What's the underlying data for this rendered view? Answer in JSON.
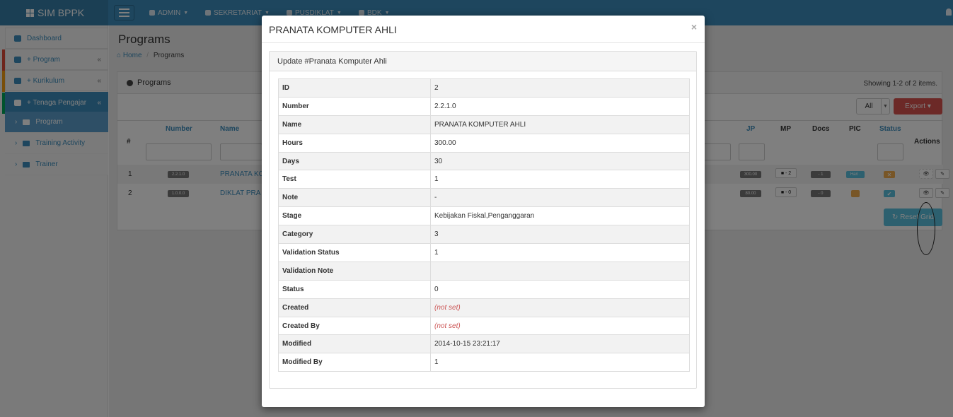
{
  "app": {
    "brand": "SIM BPPK"
  },
  "topmenu": [
    {
      "label": "ADMIN",
      "icon": "dashboard-icon"
    },
    {
      "label": "SEKRETARIAT",
      "icon": "home-icon"
    },
    {
      "label": "PUSDIKLAT",
      "icon": "building-icon"
    },
    {
      "label": "BDK",
      "icon": "bank-icon"
    }
  ],
  "sidebar": {
    "items": [
      {
        "label": "Dashboard"
      },
      {
        "label": "+ Program",
        "chevron": "«"
      },
      {
        "label": "+ Kurikulum",
        "chevron": "«"
      },
      {
        "label": "+ Tenaga Pengajar",
        "chevron": "«"
      }
    ],
    "subitems": [
      {
        "label": "Program"
      },
      {
        "label": "Training Activity"
      },
      {
        "label": "Trainer"
      }
    ]
  },
  "page": {
    "title": "Programs",
    "breadcrumb": {
      "home": "Home",
      "current": "Programs"
    }
  },
  "panel": {
    "title": "Programs",
    "summary": "Showing 1-2 of 2 items.",
    "all_label": "All",
    "export_label": "Export",
    "reset_label": "Reset Grid",
    "columns": {
      "index": "#",
      "number": "Number",
      "name": "Name",
      "jp": "JP",
      "mp": "MP",
      "docs": "Docs",
      "pic": "PIC",
      "status": "Status",
      "actions": "Actions"
    },
    "rows": [
      {
        "index": "1",
        "number": "2.2.1.0",
        "name": "PRANATA KO",
        "jp": "300.00",
        "mp": "- 2",
        "docs": "- 1",
        "pic": "Hari ."
      },
      {
        "index": "2",
        "number": "1.0.0.0",
        "name": "DIKLAT PRA",
        "jp": "80.00",
        "mp": "- 0",
        "docs": "- 0",
        "pic": ""
      }
    ]
  },
  "modal": {
    "title": "PRANATA KOMPUTER AHLI",
    "close": "×",
    "panel_title": "Update #Pranata Komputer Ahli",
    "fields": [
      {
        "key": "ID",
        "value": "2"
      },
      {
        "key": "Number",
        "value": "2.2.1.0"
      },
      {
        "key": "Name",
        "value": "PRANATA KOMPUTER AHLI"
      },
      {
        "key": "Hours",
        "value": "300.00"
      },
      {
        "key": "Days",
        "value": "30"
      },
      {
        "key": "Test",
        "value": "1"
      },
      {
        "key": "Note",
        "value": "-"
      },
      {
        "key": "Stage",
        "value": "Kebijakan Fiskal,Penganggaran"
      },
      {
        "key": "Category",
        "value": "3"
      },
      {
        "key": "Validation Status",
        "value": "1"
      },
      {
        "key": "Validation Note",
        "value": ""
      },
      {
        "key": "Status",
        "value": "0"
      },
      {
        "key": "Created",
        "value": "(not set)"
      },
      {
        "key": "Created By",
        "value": "(not set)"
      },
      {
        "key": "Modified",
        "value": "2014-10-15 23:21:17"
      },
      {
        "key": "Modified By",
        "value": "1"
      }
    ]
  },
  "colors": {
    "primary": "#3c8dbc",
    "danger": "#d9534f",
    "info": "#5bc0de",
    "warning": "#f0ad4e"
  }
}
